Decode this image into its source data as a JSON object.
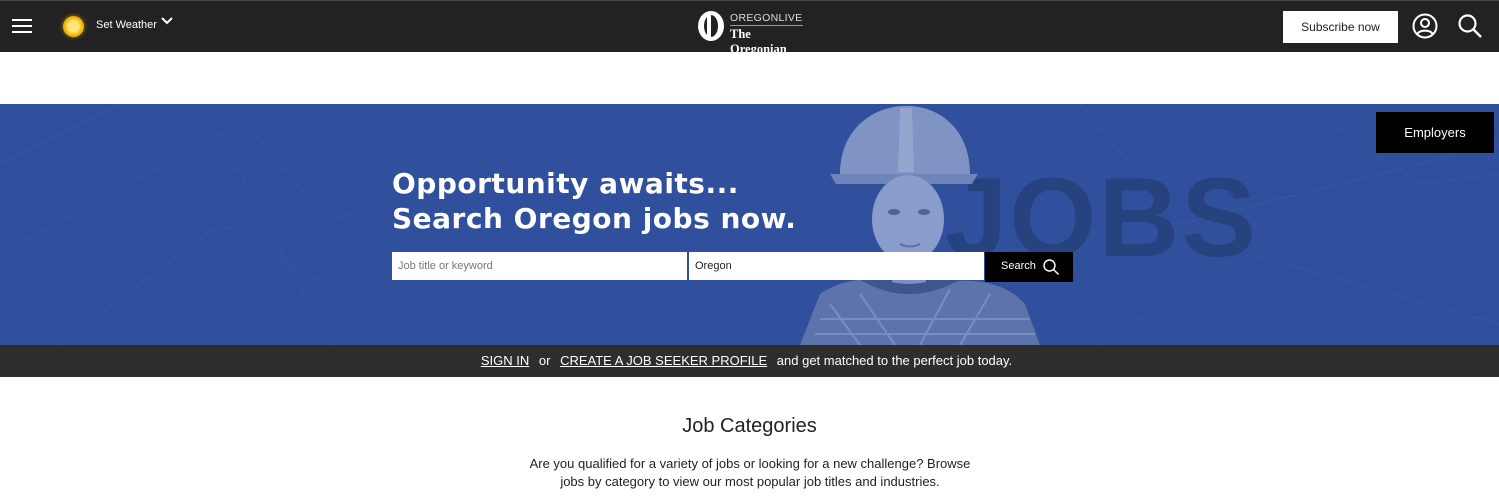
{
  "header": {
    "weather_label": "Set Weather",
    "logo_top": "OREGONLIVE",
    "logo_bottom": "The Oregonian",
    "subscribe_label": "Subscribe now"
  },
  "hero": {
    "title_line1": "Opportunity awaits...",
    "title_line2": "Search Oregon jobs now.",
    "background_word": "JOBS",
    "employers_label": "Employers",
    "keyword_placeholder": "Job title or keyword",
    "location_value": "Oregon",
    "search_label": "Search",
    "accent_color": "#30509d"
  },
  "signin_bar": {
    "signin_link": "SIGN IN",
    "or_text": "or",
    "create_profile_link": "CREATE A JOB SEEKER PROFILE",
    "tail_text": "and get matched to the perfect job today."
  },
  "categories": {
    "title": "Job Categories",
    "description": "Are you qualified for a variety of jobs or looking for a new challenge? Browse jobs by category to view our most popular job titles and industries."
  }
}
